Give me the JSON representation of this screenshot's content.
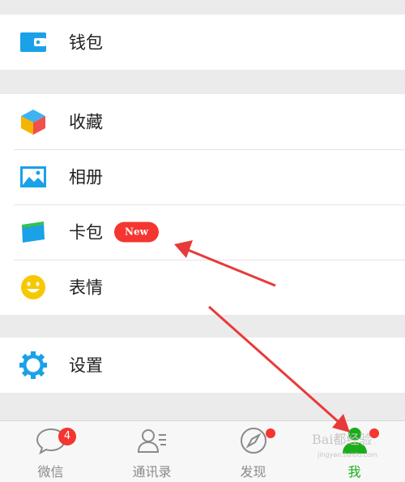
{
  "menu": {
    "wallet": {
      "label": "钱包"
    },
    "favorites": {
      "label": "收藏"
    },
    "album": {
      "label": "相册"
    },
    "cards": {
      "label": "卡包",
      "badge": "New"
    },
    "stickers": {
      "label": "表情"
    },
    "settings": {
      "label": "设置"
    }
  },
  "tabbar": {
    "chats": {
      "label": "微信",
      "badge": "4"
    },
    "contacts": {
      "label": "通讯录"
    },
    "discover": {
      "label": "发现"
    },
    "me": {
      "label": "我"
    }
  },
  "watermark": {
    "text": "Bai都经验",
    "url": "jingyan.baidu.com"
  },
  "colors": {
    "accent_green": "#1aad19",
    "badge_red": "#f43530",
    "icon_blue": "#1aa1e8",
    "arrow_red": "#e83a3a"
  },
  "icons": {
    "wallet": "wallet-icon",
    "favorites": "cube-icon",
    "album": "picture-icon",
    "cards": "card-icon",
    "stickers": "smiley-icon",
    "settings": "gear-icon",
    "chats": "chat-bubble-icon",
    "contacts": "contacts-icon",
    "discover": "compass-icon",
    "me": "person-icon"
  }
}
